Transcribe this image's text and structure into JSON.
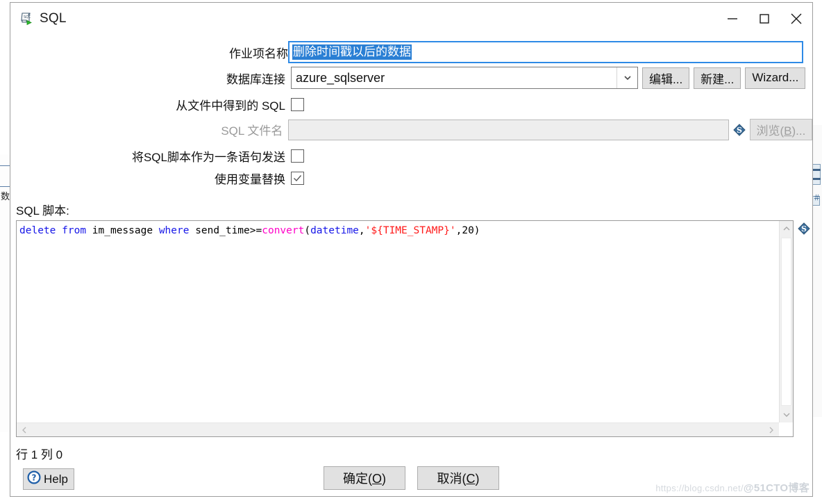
{
  "window": {
    "title": "SQL",
    "icon": "sql-script-icon",
    "controls": {
      "minimize": "minimize-icon",
      "maximize": "maximize-icon",
      "close": "close-icon"
    }
  },
  "form": {
    "job_name": {
      "label": "作业项名称",
      "value": "删除时间戳以后的数据",
      "selected": true
    },
    "connection": {
      "label": "数据库连接",
      "value": "azure_sqlserver",
      "edit_button": "编辑...",
      "new_button": "新建...",
      "wizard_button": "Wizard..."
    },
    "sql_from_file": {
      "label": "从文件中得到的 SQL",
      "checked": false
    },
    "sql_filename": {
      "label": "SQL 文件名",
      "value": "",
      "placeholder": "",
      "disabled": true,
      "browse_button": "浏览(B)...",
      "browse_mnemonic": "B",
      "variable_icon": "variable-diamond-icon"
    },
    "send_as_single_statement": {
      "label": "将SQL脚本作为一条语句发送",
      "checked": false
    },
    "use_variable_substitution": {
      "label": "使用变量替换",
      "checked": true
    }
  },
  "sql_editor": {
    "label": "SQL 脚本:",
    "variable_icon": "variable-diamond-icon",
    "tokens": [
      {
        "text": "delete",
        "type": "keyword"
      },
      {
        "text": " ",
        "type": "plain"
      },
      {
        "text": "from",
        "type": "keyword"
      },
      {
        "text": " im_message ",
        "type": "plain"
      },
      {
        "text": "where",
        "type": "keyword"
      },
      {
        "text": " send_time>=",
        "type": "plain"
      },
      {
        "text": "convert",
        "type": "function"
      },
      {
        "text": "(",
        "type": "plain"
      },
      {
        "text": "datetime",
        "type": "keyword"
      },
      {
        "text": ",",
        "type": "plain"
      },
      {
        "text": "'${TIME_STAMP}'",
        "type": "string"
      },
      {
        "text": ",20)",
        "type": "plain"
      }
    ],
    "plain_text": "delete from im_message where send_time>=convert(datetime,'${TIME_STAMP}',20)",
    "scroll_up": "scroll-up-icon",
    "scroll_down": "scroll-down-icon",
    "scroll_left": "scroll-left-icon",
    "scroll_right": "scroll-right-icon"
  },
  "status": {
    "text": "行 1 列 0"
  },
  "buttons": {
    "help": "Help",
    "help_icon": "help-question-icon",
    "ok": "确定(O)",
    "ok_mnemonic": "O",
    "cancel": "取消(C)",
    "cancel_mnemonic": "C"
  },
  "watermark": {
    "url": "https://blog.csdn.net/",
    "tag": "@51CTO博客"
  },
  "colors": {
    "accent": "#2a7fd4",
    "keyword": "#1515e8",
    "function": "#ff00c8",
    "string": "#ff1a1a",
    "button_face": "#e1e1e1",
    "disabled_text": "#9a9a9a"
  }
}
